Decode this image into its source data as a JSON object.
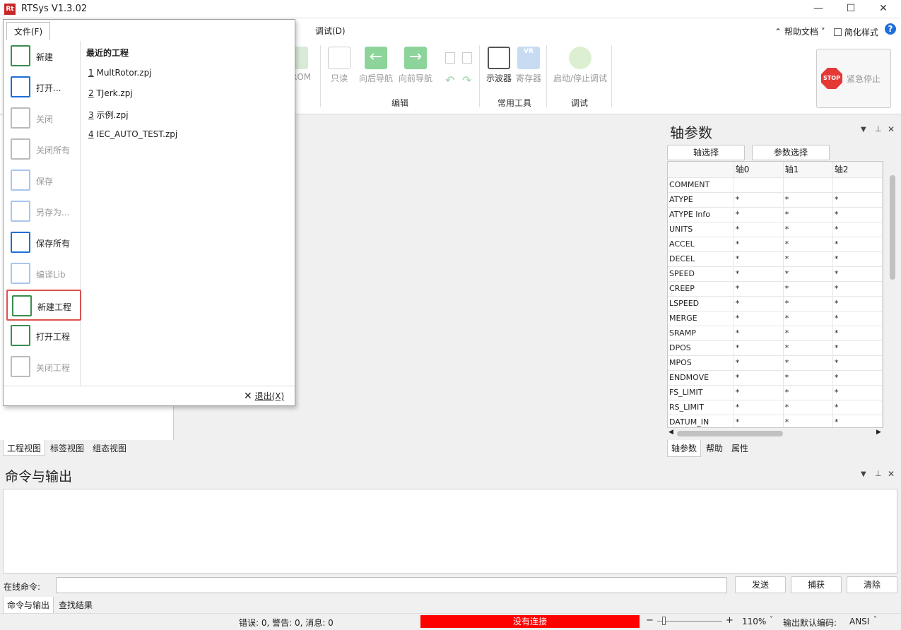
{
  "app": {
    "title": "RTSys V1.3.02",
    "logo": "Rt"
  },
  "window": {
    "min": "—",
    "max": "☐",
    "close": "✕"
  },
  "ribbon": {
    "tab_debug": "调试(D)",
    "help_docs": "帮助文档",
    "simplify": "简化样式",
    "buttons": {
      "rom": "ROM",
      "readonly": "只读",
      "nav_back": "向后导航",
      "nav_fwd": "向前导航",
      "scope": "示波器",
      "register": "寄存器",
      "start_debug": "启动/停止调试",
      "estop": "紧急停止",
      "stop_sign": "STOP",
      "vr": "VR"
    },
    "groups": {
      "edit": "编辑",
      "tools": "常用工具",
      "debug": "调试"
    }
  },
  "file_menu": {
    "tab": "文件(F)",
    "items": [
      {
        "label": "新建",
        "enabled": true,
        "icon": "new-file-icon"
      },
      {
        "label": "打开...",
        "enabled": true,
        "icon": "open-folder-icon"
      },
      {
        "label": "关闭",
        "enabled": false,
        "icon": "close-file-icon"
      },
      {
        "label": "关闭所有",
        "enabled": false,
        "icon": "close-all-icon"
      },
      {
        "label": "保存",
        "enabled": false,
        "icon": "save-icon"
      },
      {
        "label": "另存为...",
        "enabled": false,
        "icon": "save-as-icon"
      },
      {
        "label": "保存所有",
        "enabled": true,
        "icon": "save-all-icon"
      },
      {
        "label": "编译Lib",
        "enabled": false,
        "icon": "compile-lib-icon"
      },
      {
        "label": "新建工程",
        "enabled": true,
        "icon": "new-project-icon"
      },
      {
        "label": "打开工程",
        "enabled": true,
        "icon": "open-project-icon"
      },
      {
        "label": "关闭工程",
        "enabled": false,
        "icon": "close-project-icon"
      }
    ],
    "recent_title": "最近的工程",
    "recent": [
      {
        "num": "1",
        "name": "MultRotor.zpj"
      },
      {
        "num": "2",
        "name": "TJerk.zpj"
      },
      {
        "num": "3",
        "name": "示例.zpj"
      },
      {
        "num": "4",
        "name": "IEC_AUTO_TEST.zpj"
      }
    ],
    "exit": "退出(X)"
  },
  "left_tabs": [
    "工程视图",
    "标签视图",
    "组态视图"
  ],
  "axis_panel": {
    "title": "轴参数",
    "btn_axis": "轴选择",
    "btn_param": "参数选择",
    "columns": [
      "轴0",
      "轴1",
      "轴2"
    ],
    "rows": [
      {
        "name": "COMMENT",
        "v": [
          "",
          "",
          ""
        ]
      },
      {
        "name": "ATYPE",
        "v": [
          "*",
          "*",
          "*"
        ]
      },
      {
        "name": "ATYPE Info",
        "v": [
          "*",
          "*",
          "*"
        ]
      },
      {
        "name": "UNITS",
        "v": [
          "*",
          "*",
          "*"
        ]
      },
      {
        "name": "ACCEL",
        "v": [
          "*",
          "*",
          "*"
        ]
      },
      {
        "name": "DECEL",
        "v": [
          "*",
          "*",
          "*"
        ]
      },
      {
        "name": "SPEED",
        "v": [
          "*",
          "*",
          "*"
        ]
      },
      {
        "name": "CREEP",
        "v": [
          "*",
          "*",
          "*"
        ]
      },
      {
        "name": "LSPEED",
        "v": [
          "*",
          "*",
          "*"
        ]
      },
      {
        "name": "MERGE",
        "v": [
          "*",
          "*",
          "*"
        ]
      },
      {
        "name": "SRAMP",
        "v": [
          "*",
          "*",
          "*"
        ]
      },
      {
        "name": "DPOS",
        "v": [
          "*",
          "*",
          "*"
        ]
      },
      {
        "name": "MPOS",
        "v": [
          "*",
          "*",
          "*"
        ]
      },
      {
        "name": "ENDMOVE",
        "v": [
          "*",
          "*",
          "*"
        ]
      },
      {
        "name": "FS_LIMIT",
        "v": [
          "*",
          "*",
          "*"
        ]
      },
      {
        "name": "RS_LIMIT",
        "v": [
          "*",
          "*",
          "*"
        ]
      },
      {
        "name": "DATUM_IN",
        "v": [
          "*",
          "*",
          "*"
        ]
      }
    ],
    "tabs": [
      "轴参数",
      "帮助",
      "属性"
    ]
  },
  "output": {
    "title": "命令与输出",
    "cmd_label": "在线命令:",
    "send": "发送",
    "capture": "捕获",
    "clear": "清除",
    "tabs": [
      "命令与输出",
      "查找结果"
    ]
  },
  "status": {
    "messages": "错误: 0, 警告: 0, 消息: 0",
    "connection": "没有连接",
    "zoom": "110%",
    "encoding_label": "输出默认编码:",
    "encoding": "ANSI",
    "minus": "−",
    "plus": "+"
  },
  "colors": {
    "accent": "#1e6fd9",
    "danger": "#ff0000",
    "highlight": "#d9534f"
  }
}
